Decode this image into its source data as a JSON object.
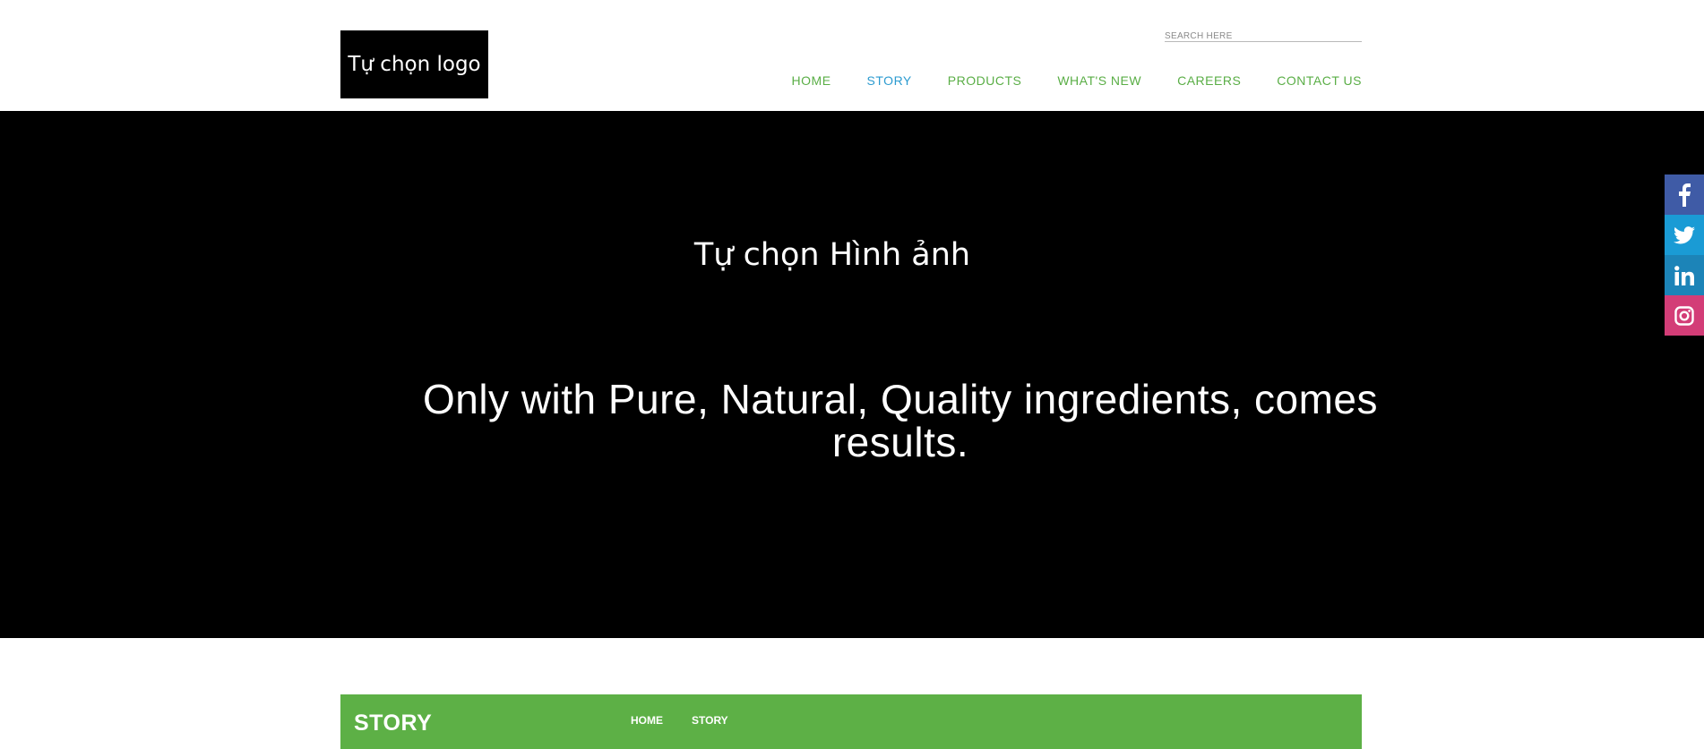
{
  "header": {
    "logo_text": "Tự chọn logo",
    "search": {
      "placeholder": "SEARCH HERE"
    },
    "nav": [
      {
        "label": "HOME"
      },
      {
        "label": "STORY",
        "active": true
      },
      {
        "label": "PRODUCTS"
      },
      {
        "label": "WHAT'S NEW"
      },
      {
        "label": "CAREERS"
      },
      {
        "label": "CONTACT US"
      }
    ]
  },
  "hero": {
    "image_placeholder": "Tự chọn Hình ảnh",
    "headline": "Only with Pure, Natural, Quality ingredients, comes results."
  },
  "story_bar": {
    "title": "STORY",
    "breadcrumb": [
      {
        "label": "HOME"
      },
      {
        "label": "STORY"
      }
    ]
  },
  "social": [
    {
      "network": "facebook",
      "icon": "facebook-icon",
      "color": "#3f5ba6"
    },
    {
      "network": "twitter",
      "icon": "twitter-icon",
      "color": "#1a9bd5"
    },
    {
      "network": "linkedin",
      "icon": "linkedin-icon",
      "color": "#1c84b8"
    },
    {
      "network": "instagram",
      "icon": "instagram-icon",
      "color": "#d33d77"
    }
  ],
  "colors": {
    "nav_green": "#5aae46",
    "nav_active_blue": "#2c9bd0",
    "story_bar_green": "#5db046",
    "hero_background": "#000000"
  }
}
